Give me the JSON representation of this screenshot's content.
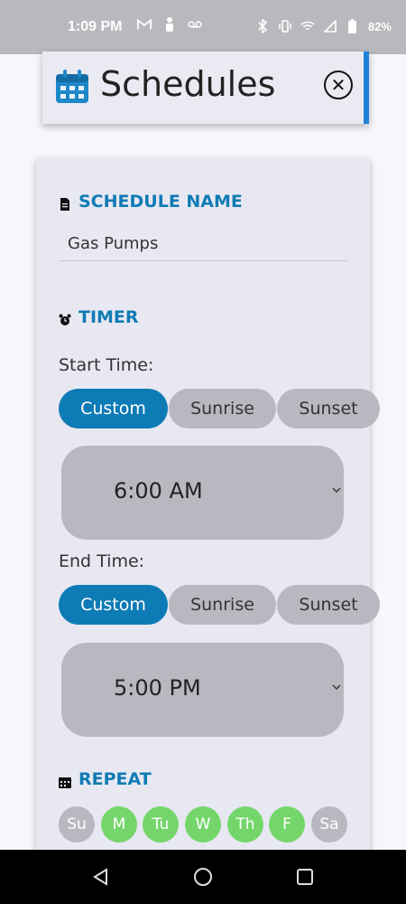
{
  "status_bar": {
    "time": "1:09 PM",
    "left_icons": [
      "gmail-icon",
      "notification-icon",
      "voicemail-icon"
    ],
    "right_icons": [
      "bluetooth-icon",
      "vibrate-icon",
      "wifi-icon",
      "signal-icon",
      "battery-icon"
    ],
    "battery": "82%"
  },
  "header": {
    "title": "Schedules",
    "icon": "calendar-icon",
    "close_icon": "close-icon",
    "close_symbol": "✕"
  },
  "schedule_name": {
    "label": "SCHEDULE NAME",
    "icon": "document-icon",
    "value": "Gas Pumps"
  },
  "timer": {
    "label": "TIMER",
    "icon": "alarm-clock-icon",
    "start": {
      "label": "Start Time:",
      "options": [
        "Custom",
        "Sunrise",
        "Sunset"
      ],
      "selected": "Custom",
      "time": "6:00 AM"
    },
    "end": {
      "label": "End Time:",
      "options": [
        "Custom",
        "Sunrise",
        "Sunset"
      ],
      "selected": "Custom",
      "time": "5:00 PM"
    }
  },
  "repeat": {
    "label": "REPEAT",
    "icon": "calendar-small-icon",
    "days": [
      {
        "label": "Su",
        "on": false
      },
      {
        "label": "M",
        "on": true
      },
      {
        "label": "Tu",
        "on": true
      },
      {
        "label": "W",
        "on": true
      },
      {
        "label": "Th",
        "on": true
      },
      {
        "label": "F",
        "on": true
      },
      {
        "label": "Sa",
        "on": false
      }
    ]
  },
  "colors": {
    "accent": "#0d7bb5",
    "day_on": "#74d66a",
    "inactive": "#b8b8c1",
    "header_edge": "#1f82d9"
  },
  "nav_bar": {
    "buttons": [
      "back-icon",
      "home-icon",
      "recents-icon"
    ]
  }
}
